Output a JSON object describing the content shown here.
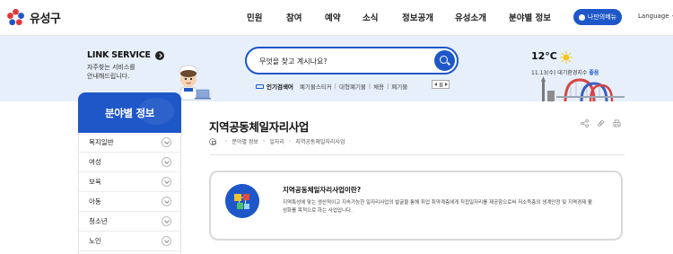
{
  "header": {
    "logo_text": "유성구",
    "nav": [
      "민원",
      "참여",
      "예약",
      "소식",
      "정보공개",
      "유성소개",
      "분야별 정보"
    ],
    "people_menu_label": "나만의메뉴",
    "language_label": "Language"
  },
  "service": {
    "title": "LINK SERVICE",
    "desc_line1": "자주찾는 서비스를",
    "desc_line2": "안내해드립니다."
  },
  "search": {
    "placeholder": "무엇을 찾고 계시나요?",
    "popular_label": "인기검색어",
    "keywords": [
      "폐기물스티커",
      "대형폐기물",
      "채용",
      "폐기물"
    ]
  },
  "weather": {
    "temperature": "12°C",
    "date_text": "11.13(수) 대기환경지수",
    "air_quality": "좋음"
  },
  "sidebar": {
    "title": "분야별 정보",
    "items": [
      "복지일반",
      "여성",
      "보육",
      "아동",
      "청소년",
      "노인"
    ]
  },
  "content": {
    "title": "지역공동체일자리사업",
    "breadcrumb": [
      "분야별 정보",
      "일자리",
      "지역공동체일자리사업"
    ],
    "info_title": "지역공동체일자리사업이란?",
    "info_text": "지역특성에 맞는 생산적이고 지속가능한 일자리사업의 발굴을 통해 취업 취약계층에게 직접일자리를 제공함으로써 저소득층의 생계안정 및 지역경제 활성화를 목적으로 하는 사업입니다."
  },
  "colors": {
    "primary": "#1e57c8",
    "band_bg": "#e7effa"
  },
  "icons": {
    "logo": "yuseong-logo-icon",
    "search": "search-icon",
    "weather": "sun-icon",
    "home": "home-icon",
    "share": "share-icon",
    "link": "link-icon",
    "print": "print-icon",
    "info": "cubes-icon"
  }
}
